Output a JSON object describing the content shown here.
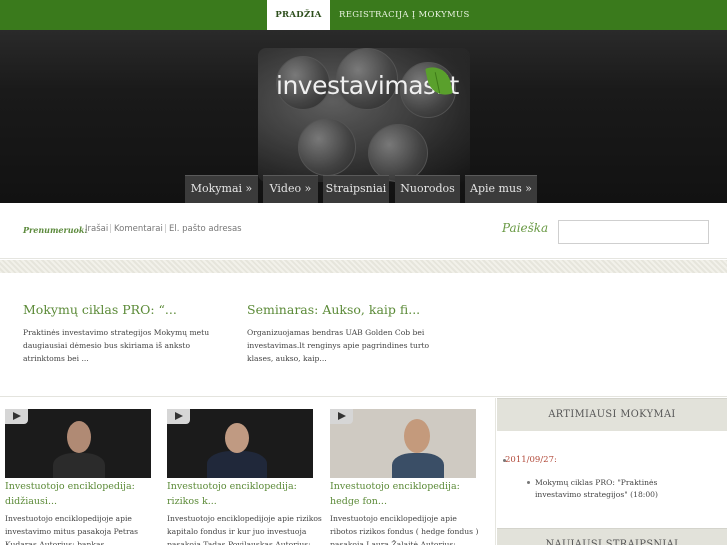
{
  "topnav": {
    "items": [
      {
        "label": "PRADŽIA"
      },
      {
        "label": "REGISTRACIJA Į MOKYMUS"
      }
    ]
  },
  "logo": {
    "name": "investavimas",
    "tld": ".lt"
  },
  "mainnav": {
    "items": [
      {
        "label": "Mokymai »"
      },
      {
        "label": "Video »"
      },
      {
        "label": "Straipsniai"
      },
      {
        "label": "Nuorodos"
      },
      {
        "label": "Apie mus »"
      }
    ]
  },
  "subscribe": {
    "label": "Prenumeruok:",
    "links": [
      "Įrašai",
      "Komentarai",
      "El. pašto adresas"
    ]
  },
  "search": {
    "label": "Paieška",
    "value": ""
  },
  "featured": [
    {
      "title": "Mokymų ciklas PRO: “...",
      "text": "Praktinės investavimo strategijos Mokymų metu daugiausiai dėmesio bus skiriama iš anksto atrinktoms bei ..."
    },
    {
      "title": "Seminaras: Aukso, kaip fi...",
      "text": "Organizuojamas bendras UAB Golden Cob bei investavimas.lt renginys apie pagrindines turto klases, aukso, kaip..."
    }
  ],
  "videos": [
    {
      "title": "Investuotojo enciklopedija: didžiausi...",
      "text": "Investuotojo enciklopedijoje apie investavimo mitus pasakoja Petras Kudaras Autorius: bankas"
    },
    {
      "title": "Investuotojo enciklopedija: rizikos k...",
      "text": "Investuotojo enciklopedijoje apie rizikos kapitalo fondus ir kur juo investuoja pasakoja Tadas Povilauskas Autorius:"
    },
    {
      "title": "Investuotojo enciklopedija: hedge fon...",
      "text": "Investuotojo enciklopedijoje apie ribotos rizikos fondus ( hedge fondus ) pasakoja Laura Žalaitė Autorius: bankas"
    }
  ],
  "sidebar": {
    "upcoming_title": "ARTIMIAUSI MOKYMAI",
    "upcoming_date": "2011/09/27:",
    "upcoming_item": "Mokymų ciklas PRO: \"Praktinės investavimo strategijos\" (18:00)",
    "latest_title": "NAUJAUSI STRAIPSNIAI"
  },
  "colors": {
    "brand_green": "#3a7a1c",
    "link_green": "#5b8a37",
    "date_red": "#b24a3a"
  }
}
